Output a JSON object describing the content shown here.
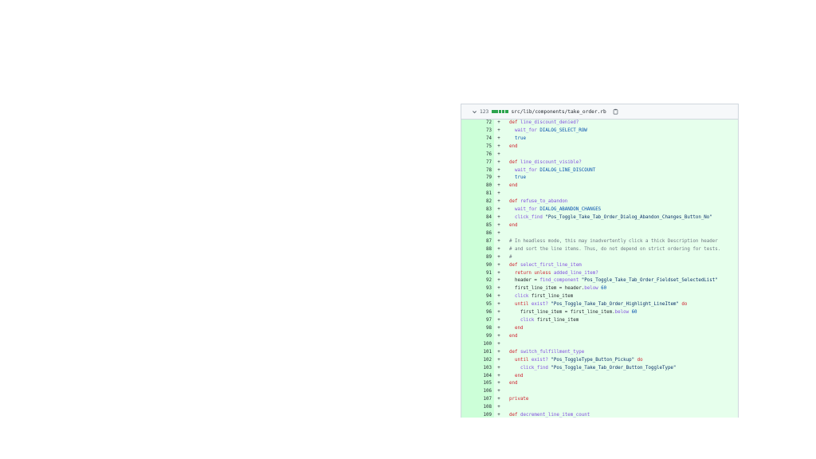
{
  "file": {
    "change_count": "123",
    "path": "src/lib/components/take_order.rb",
    "bar_colors": [
      "#2da44e",
      "#2da44e",
      "#2da44e",
      "#2da44e",
      "#2da44e"
    ]
  },
  "colors": {
    "added_bg": "#e6ffec",
    "added_num_bg": "#ccffd8"
  },
  "lines": [
    {
      "num": "72",
      "sign": "+",
      "tokens": [
        {
          "t": "  "
        },
        {
          "t": "def",
          "c": "k"
        },
        {
          "t": " "
        },
        {
          "t": "line_discount_denied?",
          "c": "f"
        }
      ]
    },
    {
      "num": "73",
      "sign": "+",
      "tokens": [
        {
          "t": "    "
        },
        {
          "t": "wait_for",
          "c": "f"
        },
        {
          "t": " "
        },
        {
          "t": "DIALOG_SELECT_ROW",
          "c": "c"
        }
      ]
    },
    {
      "num": "74",
      "sign": "+",
      "tokens": [
        {
          "t": "    "
        },
        {
          "t": "true",
          "c": "c"
        }
      ]
    },
    {
      "num": "75",
      "sign": "+",
      "tokens": [
        {
          "t": "  "
        },
        {
          "t": "end",
          "c": "k"
        }
      ]
    },
    {
      "num": "76",
      "sign": "+",
      "tokens": []
    },
    {
      "num": "77",
      "sign": "+",
      "tokens": [
        {
          "t": "  "
        },
        {
          "t": "def",
          "c": "k"
        },
        {
          "t": " "
        },
        {
          "t": "line_discount_visible?",
          "c": "f"
        }
      ]
    },
    {
      "num": "78",
      "sign": "+",
      "tokens": [
        {
          "t": "    "
        },
        {
          "t": "wait_for",
          "c": "f"
        },
        {
          "t": " "
        },
        {
          "t": "DIALOG_LINE_DISCOUNT",
          "c": "c"
        }
      ]
    },
    {
      "num": "79",
      "sign": "+",
      "tokens": [
        {
          "t": "    "
        },
        {
          "t": "true",
          "c": "c"
        }
      ]
    },
    {
      "num": "80",
      "sign": "+",
      "tokens": [
        {
          "t": "  "
        },
        {
          "t": "end",
          "c": "k"
        }
      ]
    },
    {
      "num": "81",
      "sign": "+",
      "tokens": []
    },
    {
      "num": "82",
      "sign": "+",
      "tokens": [
        {
          "t": "  "
        },
        {
          "t": "def",
          "c": "k"
        },
        {
          "t": " "
        },
        {
          "t": "refuse_to_abandon",
          "c": "f"
        }
      ]
    },
    {
      "num": "83",
      "sign": "+",
      "tokens": [
        {
          "t": "    "
        },
        {
          "t": "wait_for",
          "c": "f"
        },
        {
          "t": " "
        },
        {
          "t": "DIALOG_ABANDON_CHANGES",
          "c": "c"
        }
      ]
    },
    {
      "num": "84",
      "sign": "+",
      "tokens": [
        {
          "t": "    "
        },
        {
          "t": "click_find",
          "c": "f"
        },
        {
          "t": " "
        },
        {
          "t": "\"Pos_Toggle_Take_Tab_Order_Dialog_Abandon_Changes_Button_No\"",
          "c": "s"
        }
      ]
    },
    {
      "num": "85",
      "sign": "+",
      "tokens": [
        {
          "t": "  "
        },
        {
          "t": "end",
          "c": "k"
        }
      ]
    },
    {
      "num": "86",
      "sign": "+",
      "tokens": []
    },
    {
      "num": "87",
      "sign": "+",
      "tokens": [
        {
          "t": "  "
        },
        {
          "t": "# In headless mode, this may inadvertently click a thick Description header",
          "c": "cm"
        }
      ]
    },
    {
      "num": "88",
      "sign": "+",
      "tokens": [
        {
          "t": "  "
        },
        {
          "t": "# and sort the line items. Thus, do not depend on strict ordering for tests.",
          "c": "cm"
        }
      ]
    },
    {
      "num": "89",
      "sign": "+",
      "tokens": [
        {
          "t": "  "
        },
        {
          "t": "#",
          "c": "cm"
        }
      ]
    },
    {
      "num": "90",
      "sign": "+",
      "tokens": [
        {
          "t": "  "
        },
        {
          "t": "def",
          "c": "k"
        },
        {
          "t": " "
        },
        {
          "t": "select_first_line_item",
          "c": "f"
        }
      ]
    },
    {
      "num": "91",
      "sign": "+",
      "tokens": [
        {
          "t": "    "
        },
        {
          "t": "return",
          "c": "k"
        },
        {
          "t": " "
        },
        {
          "t": "unless",
          "c": "k"
        },
        {
          "t": " "
        },
        {
          "t": "added_line_item?",
          "c": "f"
        }
      ]
    },
    {
      "num": "92",
      "sign": "+",
      "tokens": [
        {
          "t": "    header = "
        },
        {
          "t": "find_component",
          "c": "f"
        },
        {
          "t": " "
        },
        {
          "t": "\"Pos_Toggle_Take_Tab_Order_Fieldset_SelectedList\"",
          "c": "s"
        }
      ]
    },
    {
      "num": "93",
      "sign": "+",
      "tokens": [
        {
          "t": "    first_line_item = header."
        },
        {
          "t": "below",
          "c": "f"
        },
        {
          "t": " "
        },
        {
          "t": "60",
          "c": "c"
        }
      ]
    },
    {
      "num": "94",
      "sign": "+",
      "tokens": [
        {
          "t": "    "
        },
        {
          "t": "click",
          "c": "f"
        },
        {
          "t": " first_line_item"
        }
      ]
    },
    {
      "num": "95",
      "sign": "+",
      "tokens": [
        {
          "t": "    "
        },
        {
          "t": "until",
          "c": "k"
        },
        {
          "t": " "
        },
        {
          "t": "exist?",
          "c": "f"
        },
        {
          "t": " "
        },
        {
          "t": "\"Pos_Toggle_Take_Tab_Order_Highlight_LineItem\"",
          "c": "s"
        },
        {
          "t": " "
        },
        {
          "t": "do",
          "c": "k"
        }
      ]
    },
    {
      "num": "96",
      "sign": "+",
      "tokens": [
        {
          "t": "      first_line_item = first_line_item."
        },
        {
          "t": "below",
          "c": "f"
        },
        {
          "t": " "
        },
        {
          "t": "60",
          "c": "c"
        }
      ]
    },
    {
      "num": "97",
      "sign": "+",
      "tokens": [
        {
          "t": "      "
        },
        {
          "t": "click",
          "c": "f"
        },
        {
          "t": " first_line_item"
        }
      ]
    },
    {
      "num": "98",
      "sign": "+",
      "tokens": [
        {
          "t": "    "
        },
        {
          "t": "end",
          "c": "k"
        }
      ]
    },
    {
      "num": "99",
      "sign": "+",
      "tokens": [
        {
          "t": "  "
        },
        {
          "t": "end",
          "c": "k"
        }
      ]
    },
    {
      "num": "100",
      "sign": "+",
      "tokens": []
    },
    {
      "num": "101",
      "sign": "+",
      "tokens": [
        {
          "t": "  "
        },
        {
          "t": "def",
          "c": "k"
        },
        {
          "t": " "
        },
        {
          "t": "switch_fulfillment_type",
          "c": "f"
        }
      ]
    },
    {
      "num": "102",
      "sign": "+",
      "tokens": [
        {
          "t": "    "
        },
        {
          "t": "until",
          "c": "k"
        },
        {
          "t": " "
        },
        {
          "t": "exist?",
          "c": "f"
        },
        {
          "t": " "
        },
        {
          "t": "\"Pos_ToggleType_Button_Pickup\"",
          "c": "s"
        },
        {
          "t": " "
        },
        {
          "t": "do",
          "c": "k"
        }
      ]
    },
    {
      "num": "103",
      "sign": "+",
      "tokens": [
        {
          "t": "      "
        },
        {
          "t": "click_find",
          "c": "f"
        },
        {
          "t": " "
        },
        {
          "t": "\"Pos_Toggle_Take_Tab_Order_Button_ToggleType\"",
          "c": "s"
        }
      ]
    },
    {
      "num": "104",
      "sign": "+",
      "tokens": [
        {
          "t": "    "
        },
        {
          "t": "end",
          "c": "k"
        }
      ]
    },
    {
      "num": "105",
      "sign": "+",
      "tokens": [
        {
          "t": "  "
        },
        {
          "t": "end",
          "c": "k"
        }
      ]
    },
    {
      "num": "106",
      "sign": "+",
      "tokens": []
    },
    {
      "num": "107",
      "sign": "+",
      "tokens": [
        {
          "t": "  "
        },
        {
          "t": "private",
          "c": "k"
        }
      ]
    },
    {
      "num": "108",
      "sign": "+",
      "tokens": []
    },
    {
      "num": "109",
      "sign": "+",
      "tokens": [
        {
          "t": "  "
        },
        {
          "t": "def",
          "c": "k"
        },
        {
          "t": " "
        },
        {
          "t": "decrement_line_item_count",
          "c": "f"
        }
      ]
    }
  ]
}
